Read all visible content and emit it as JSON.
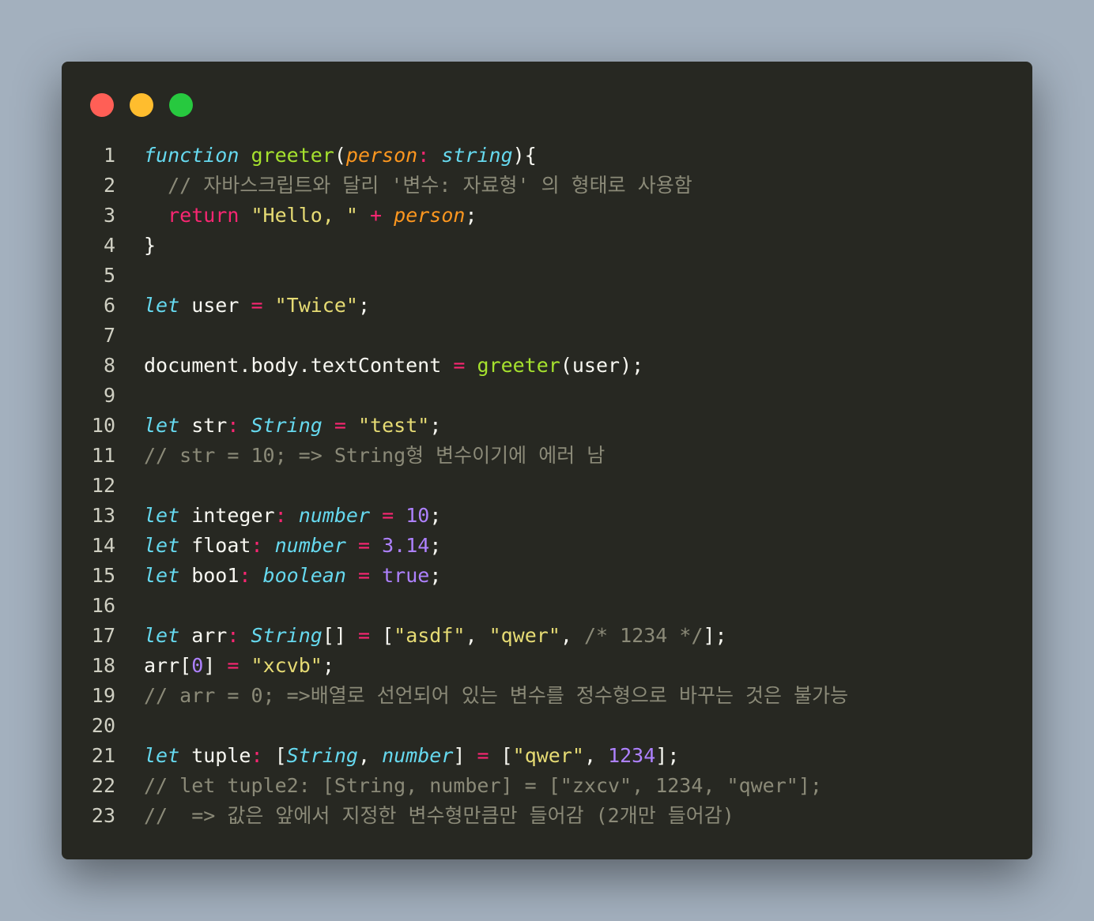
{
  "window": {
    "controls": [
      {
        "name": "close",
        "color": "#ff5f56"
      },
      {
        "name": "minimize",
        "color": "#ffbd2e"
      },
      {
        "name": "zoom",
        "color": "#27c93f"
      }
    ]
  },
  "code": {
    "lines": [
      {
        "n": "1",
        "tokens": [
          [
            "kw",
            "function"
          ],
          [
            "plain",
            " "
          ],
          [
            "fn",
            "greeter"
          ],
          [
            "plain",
            "("
          ],
          [
            "param",
            "person"
          ],
          [
            "op",
            ":"
          ],
          [
            "plain",
            " "
          ],
          [
            "type",
            "string"
          ],
          [
            "plain",
            "){"
          ]
        ]
      },
      {
        "n": "2",
        "tokens": [
          [
            "com",
            "  // 자바스크립트와 달리 '변수: 자료형' 의 형태로 사용함"
          ]
        ]
      },
      {
        "n": "3",
        "tokens": [
          [
            "plain",
            "  "
          ],
          [
            "ret",
            "return"
          ],
          [
            "plain",
            " "
          ],
          [
            "str",
            "\"Hello, \""
          ],
          [
            "plain",
            " "
          ],
          [
            "op",
            "+"
          ],
          [
            "plain",
            " "
          ],
          [
            "param",
            "person"
          ],
          [
            "plain",
            ";"
          ]
        ]
      },
      {
        "n": "4",
        "tokens": [
          [
            "plain",
            "}"
          ]
        ]
      },
      {
        "n": "5",
        "tokens": []
      },
      {
        "n": "6",
        "tokens": [
          [
            "kw",
            "let"
          ],
          [
            "plain",
            " user "
          ],
          [
            "op",
            "="
          ],
          [
            "plain",
            " "
          ],
          [
            "str",
            "\"Twice\""
          ],
          [
            "plain",
            ";"
          ]
        ]
      },
      {
        "n": "7",
        "tokens": []
      },
      {
        "n": "8",
        "tokens": [
          [
            "plain",
            "document.body.textContent "
          ],
          [
            "op",
            "="
          ],
          [
            "plain",
            " "
          ],
          [
            "fn",
            "greeter"
          ],
          [
            "plain",
            "(user);"
          ]
        ]
      },
      {
        "n": "9",
        "tokens": []
      },
      {
        "n": "10",
        "tokens": [
          [
            "kw",
            "let"
          ],
          [
            "plain",
            " str"
          ],
          [
            "op",
            ":"
          ],
          [
            "plain",
            " "
          ],
          [
            "type",
            "String"
          ],
          [
            "plain",
            " "
          ],
          [
            "op",
            "="
          ],
          [
            "plain",
            " "
          ],
          [
            "str",
            "\"test\""
          ],
          [
            "plain",
            ";"
          ]
        ]
      },
      {
        "n": "11",
        "tokens": [
          [
            "com",
            "// str = 10; => String형 변수이기에 에러 남"
          ]
        ]
      },
      {
        "n": "12",
        "tokens": []
      },
      {
        "n": "13",
        "tokens": [
          [
            "kw",
            "let"
          ],
          [
            "plain",
            " integer"
          ],
          [
            "op",
            ":"
          ],
          [
            "plain",
            " "
          ],
          [
            "type",
            "number"
          ],
          [
            "plain",
            " "
          ],
          [
            "op",
            "="
          ],
          [
            "plain",
            " "
          ],
          [
            "num",
            "10"
          ],
          [
            "plain",
            ";"
          ]
        ]
      },
      {
        "n": "14",
        "tokens": [
          [
            "kw",
            "let"
          ],
          [
            "plain",
            " float"
          ],
          [
            "op",
            ":"
          ],
          [
            "plain",
            " "
          ],
          [
            "type",
            "number"
          ],
          [
            "plain",
            " "
          ],
          [
            "op",
            "="
          ],
          [
            "plain",
            " "
          ],
          [
            "num",
            "3.14"
          ],
          [
            "plain",
            ";"
          ]
        ]
      },
      {
        "n": "15",
        "tokens": [
          [
            "kw",
            "let"
          ],
          [
            "plain",
            " boo1"
          ],
          [
            "op",
            ":"
          ],
          [
            "plain",
            " "
          ],
          [
            "type",
            "boolean"
          ],
          [
            "plain",
            " "
          ],
          [
            "op",
            "="
          ],
          [
            "plain",
            " "
          ],
          [
            "num",
            "true"
          ],
          [
            "plain",
            ";"
          ]
        ]
      },
      {
        "n": "16",
        "tokens": []
      },
      {
        "n": "17",
        "tokens": [
          [
            "kw",
            "let"
          ],
          [
            "plain",
            " arr"
          ],
          [
            "op",
            ":"
          ],
          [
            "plain",
            " "
          ],
          [
            "type",
            "String"
          ],
          [
            "plain",
            "[] "
          ],
          [
            "op",
            "="
          ],
          [
            "plain",
            " ["
          ],
          [
            "str",
            "\"asdf\""
          ],
          [
            "plain",
            ", "
          ],
          [
            "str",
            "\"qwer\""
          ],
          [
            "plain",
            ", "
          ],
          [
            "com",
            "/* 1234 */"
          ],
          [
            "plain",
            "];"
          ]
        ]
      },
      {
        "n": "18",
        "tokens": [
          [
            "plain",
            "arr["
          ],
          [
            "num",
            "0"
          ],
          [
            "plain",
            "] "
          ],
          [
            "op",
            "="
          ],
          [
            "plain",
            " "
          ],
          [
            "str",
            "\"xcvb\""
          ],
          [
            "plain",
            ";"
          ]
        ]
      },
      {
        "n": "19",
        "tokens": [
          [
            "com",
            "// arr = 0; =>배열로 선언되어 있는 변수를 정수형으로 바꾸는 것은 불가능"
          ]
        ]
      },
      {
        "n": "20",
        "tokens": []
      },
      {
        "n": "21",
        "tokens": [
          [
            "kw",
            "let"
          ],
          [
            "plain",
            " tuple"
          ],
          [
            "op",
            ":"
          ],
          [
            "plain",
            " ["
          ],
          [
            "type",
            "String"
          ],
          [
            "plain",
            ", "
          ],
          [
            "type",
            "number"
          ],
          [
            "plain",
            "] "
          ],
          [
            "op",
            "="
          ],
          [
            "plain",
            " ["
          ],
          [
            "str",
            "\"qwer\""
          ],
          [
            "plain",
            ", "
          ],
          [
            "num",
            "1234"
          ],
          [
            "plain",
            "];"
          ]
        ]
      },
      {
        "n": "22",
        "tokens": [
          [
            "com",
            "// let tuple2: [String, number] = [\"zxcv\", 1234, \"qwer\"];"
          ]
        ]
      },
      {
        "n": "23",
        "tokens": [
          [
            "com",
            "//  => 값은 앞에서 지정한 변수형만큼만 들어감 (2개만 들어감)"
          ]
        ]
      }
    ]
  }
}
